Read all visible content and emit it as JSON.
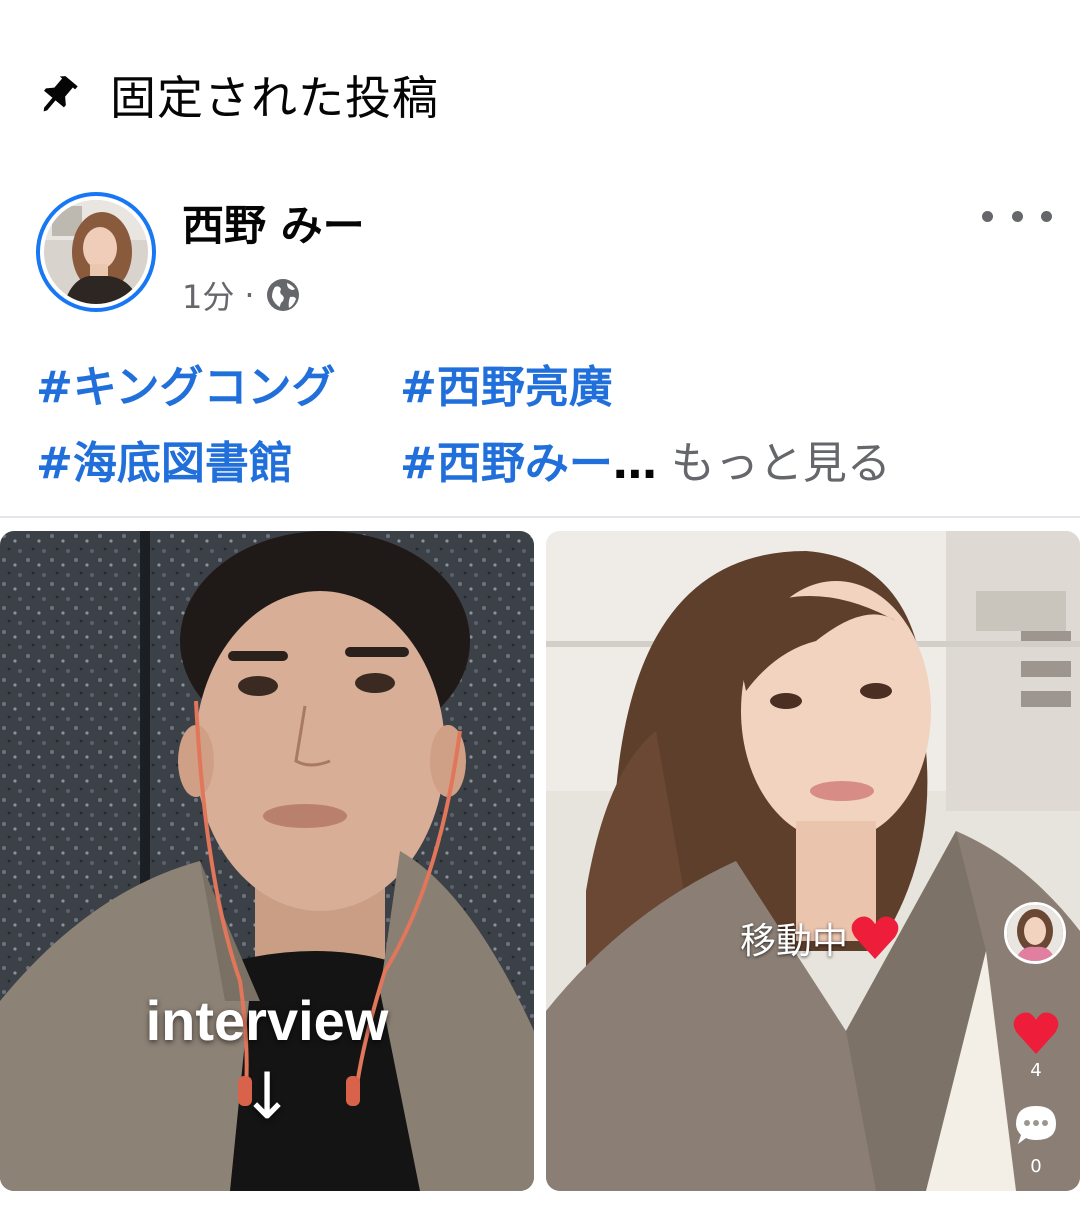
{
  "pinned": {
    "label": "固定された投稿",
    "icon": "pin-icon"
  },
  "post": {
    "author": "西野 みー",
    "time": "1分",
    "separator": "·",
    "privacy_icon": "globe-icon",
    "more_icon": "more-horizontal-icon",
    "hashtags": [
      [
        "#キングコング",
        "#西野亮廣"
      ],
      [
        "#海底図書館",
        "#西野みー"
      ]
    ],
    "ellipsis": "…",
    "see_more": "もっと見る"
  },
  "media": {
    "left": {
      "overlay_text": "interview",
      "overlay_arrow": "↓"
    },
    "right": {
      "caption": "移動中",
      "like_count": "4",
      "comment_count": "0"
    }
  },
  "colors": {
    "accent": "#1877f2",
    "hashtag": "#216fdb",
    "secondary_text": "#65676b",
    "heart": "#ee1d3a"
  }
}
